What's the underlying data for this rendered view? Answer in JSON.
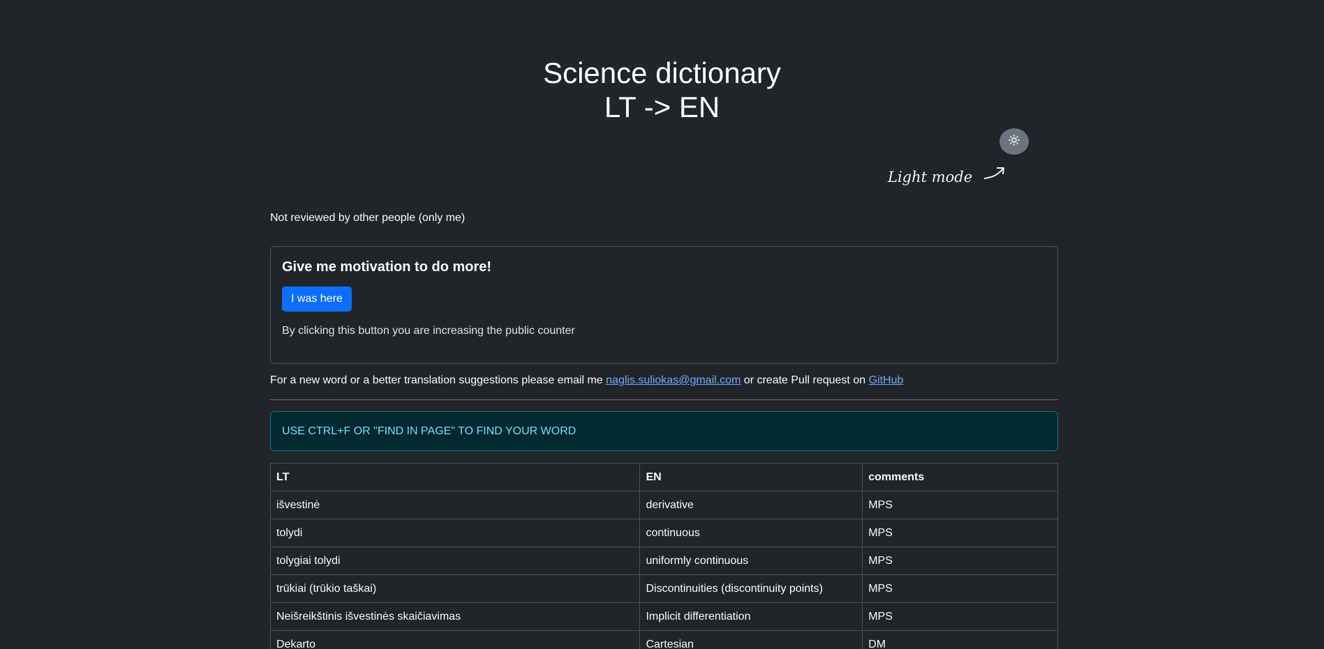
{
  "header": {
    "title_line1": "Science dictionary",
    "title_line2": "LT -> EN"
  },
  "theme_toggle": {
    "icon": "sun-icon",
    "note": "Light mode"
  },
  "review_note": "Not reviewed by other people (only me)",
  "motivation_card": {
    "title": "Give me motivation to do more!",
    "button_label": "I was here",
    "text": "By clicking this button you are increasing the public counter"
  },
  "suggestion": {
    "prefix": "For a new word or a better translation suggestions please email me",
    "email": "naglis.suliokas@gmail.com",
    "middle": "or create Pull request on",
    "github": "GitHub"
  },
  "alert_text": "USE CTRL+F OR \"FIND IN PAGE\" TO FIND YOUR WORD",
  "table": {
    "headers": [
      "LT",
      "EN",
      "comments"
    ],
    "rows": [
      [
        "išvestinė",
        "derivative",
        "MPS"
      ],
      [
        "tolydi",
        "continuous",
        "MPS"
      ],
      [
        "tolygiai tolydi",
        "uniformly continuous",
        "MPS"
      ],
      [
        "trūkiai (trūkio taškai)",
        "Discontinuities (discontinuity points)",
        "MPS"
      ],
      [
        "Neišreikštinis išvestinės skaičiavimas",
        "Implicit differentiation",
        "MPS"
      ],
      [
        "Dekarto",
        "Cartesian",
        "DM"
      ]
    ]
  },
  "colors": {
    "background": "#212529",
    "primary": "#0d6efd",
    "link": "#6ea8fe",
    "alert_text": "#6edff6",
    "alert_bg": "#032830"
  }
}
